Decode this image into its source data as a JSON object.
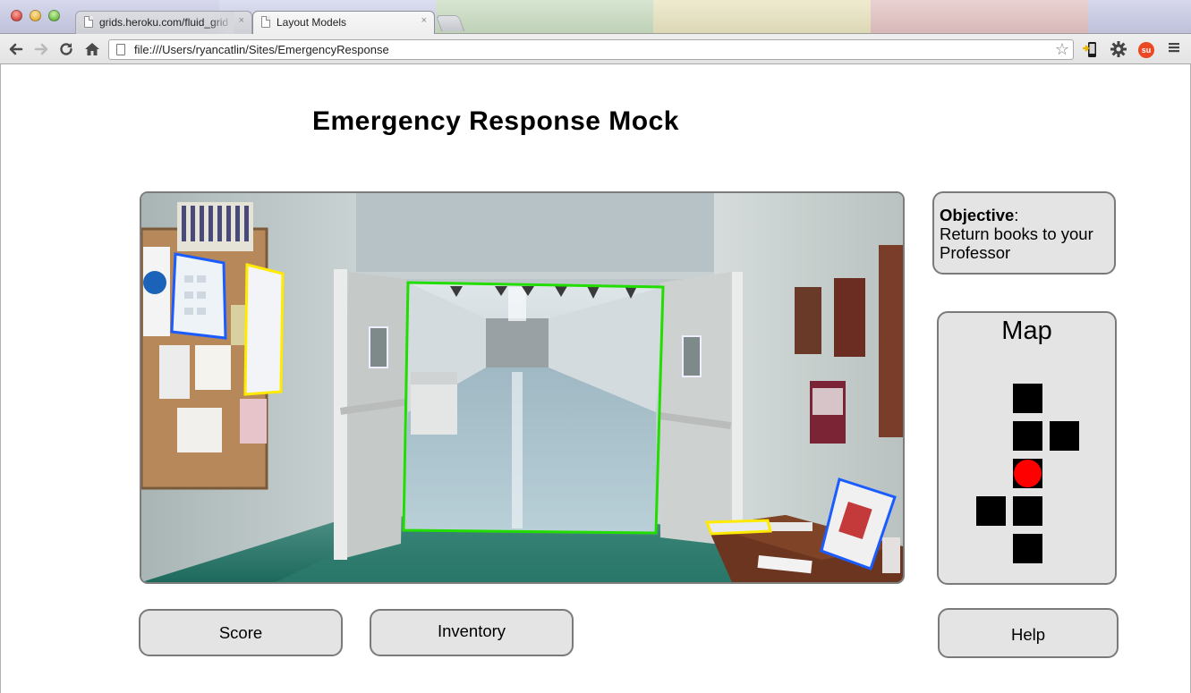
{
  "browser": {
    "tabs": [
      {
        "label": "grids.heroku.com/fluid_grid"
      },
      {
        "label": "Layout Models"
      }
    ],
    "tab_close_glyph": "×",
    "address_bar": {
      "url": "file:///Users/ryancatlin/Sites/EmergencyResponse"
    },
    "icons": [
      "back-arrow-icon",
      "forward-arrow-icon",
      "reload-icon",
      "home-icon",
      "page-icon",
      "bookmark-star-icon",
      "mobile-extension-icon",
      "wrench-icon",
      "stumbleupon-icon",
      "menu-icon"
    ]
  },
  "page": {
    "title": "Emergency Response Mock"
  },
  "objective": {
    "label": "Objective",
    "separator": ":",
    "text": "Return books to your Professor"
  },
  "map": {
    "title": "Map",
    "player_color": "#ff0000",
    "cell_color": "#000000"
  },
  "buttons": {
    "score": "Score",
    "inventory": "Inventory",
    "help": "Help"
  },
  "hotspots": {
    "doorway_color": "#22dd00",
    "poster_colors": [
      "#1a5cff",
      "#ffea00"
    ]
  }
}
